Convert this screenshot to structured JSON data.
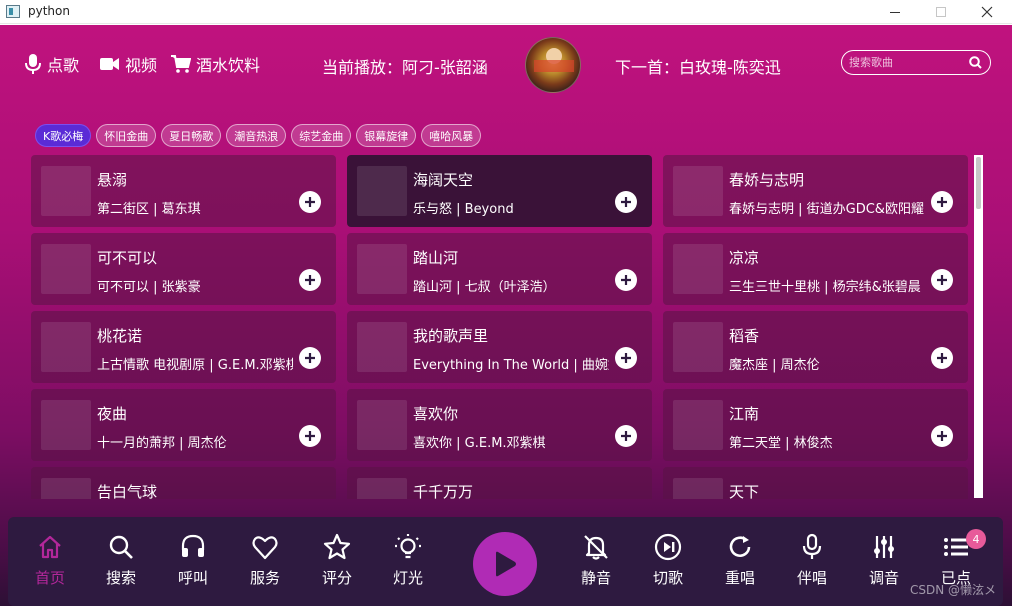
{
  "window": {
    "title": "python"
  },
  "header": {
    "nav": [
      {
        "label": "点歌",
        "icon": "microphone-icon"
      },
      {
        "label": "视频",
        "icon": "video-camera-icon"
      },
      {
        "label": "酒水饮料",
        "icon": "shopping-cart-icon"
      }
    ],
    "now_playing": "当前播放：阿刁-张韶涵",
    "next_song": "下一首：白玫瑰-陈奕迅",
    "search_placeholder": "搜索歌曲"
  },
  "categories": [
    {
      "label": "K歌必梅",
      "active": true
    },
    {
      "label": "怀旧金曲",
      "active": false
    },
    {
      "label": "夏日畅歌",
      "active": false
    },
    {
      "label": "潮音热浪",
      "active": false
    },
    {
      "label": "综艺金曲",
      "active": false
    },
    {
      "label": "银幕旋律",
      "active": false
    },
    {
      "label": "嘻哈风暴",
      "active": false
    }
  ],
  "songs": [
    {
      "title": "悬溺",
      "subtitle": "第二街区 | 葛东琪",
      "selected": false
    },
    {
      "title": "海阔天空",
      "subtitle": "乐与怒 | Beyond",
      "selected": true
    },
    {
      "title": "春娇与志明",
      "subtitle": "春娇与志明 | 街道办GDC&欧阳耀",
      "selected": false
    },
    {
      "title": "可不可以",
      "subtitle": "可不可以 | 张紫豪",
      "selected": false
    },
    {
      "title": "踏山河",
      "subtitle": "踏山河 | 七叔（叶泽浩）",
      "selected": false
    },
    {
      "title": "凉凉",
      "subtitle": "三生三世十里桃 | 杨宗纬&张碧晨",
      "selected": false
    },
    {
      "title": "桃花诺",
      "subtitle": "上古情歌 电视剧原 | G.E.M.邓紫棋",
      "selected": false
    },
    {
      "title": "我的歌声里",
      "subtitle": "Everything In The World | 曲婉婷",
      "selected": false
    },
    {
      "title": "稻香",
      "subtitle": "魔杰座 | 周杰伦",
      "selected": false
    },
    {
      "title": "夜曲",
      "subtitle": "十一月的萧邦 | 周杰伦",
      "selected": false
    },
    {
      "title": "喜欢你",
      "subtitle": "喜欢你 | G.E.M.邓紫棋",
      "selected": false
    },
    {
      "title": "江南",
      "subtitle": "第二天堂 | 林俊杰",
      "selected": false
    },
    {
      "title": "告白气球",
      "subtitle": "",
      "selected": false
    },
    {
      "title": "千千万万",
      "subtitle": "",
      "selected": false
    },
    {
      "title": "天下",
      "subtitle": "",
      "selected": false
    }
  ],
  "bottom_nav": [
    {
      "label": "首页",
      "icon": "home-icon",
      "active": true
    },
    {
      "label": "搜索",
      "icon": "search-icon",
      "active": false
    },
    {
      "label": "呼叫",
      "icon": "headset-icon",
      "active": false
    },
    {
      "label": "服务",
      "icon": "heart-hand-icon",
      "active": false
    },
    {
      "label": "评分",
      "icon": "star-icon",
      "active": false
    },
    {
      "label": "灯光",
      "icon": "bulb-icon",
      "active": false
    },
    {
      "label": "静音",
      "icon": "bell-off-icon",
      "active": false
    },
    {
      "label": "切歌",
      "icon": "skip-icon",
      "active": false
    },
    {
      "label": "重唱",
      "icon": "replay-icon",
      "active": false
    },
    {
      "label": "伴唱",
      "icon": "microphone-icon",
      "active": false
    },
    {
      "label": "调音",
      "icon": "sliders-icon",
      "active": false
    },
    {
      "label": "已点",
      "icon": "queue-list-icon",
      "active": false
    }
  ],
  "queue_count": "4",
  "watermark": "CSDN @懒泫メ",
  "colors": {
    "accent": "#b02bb5",
    "active_pill": "#5b2bd6",
    "active_nav": "#b3279a",
    "badge": "#e85a9a"
  }
}
